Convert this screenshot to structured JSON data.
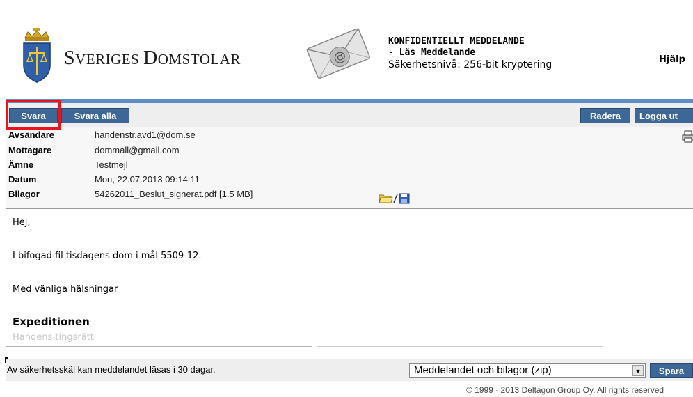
{
  "header": {
    "brand_logo": "SVERIGES DOMSTOLAR",
    "title_line1": "KONFIDENTIELLT MEDDELANDE",
    "title_line2": "- Läs Meddelande",
    "security_level": "Säkerhetsnivå: 256-bit kryptering",
    "help_label": "Hjälp",
    "band_color": "#5b8fc4"
  },
  "toolbar": {
    "reply_label": "Svara",
    "reply_all_label": "Svara alla",
    "delete_label": "Radera",
    "logout_label": "Logga ut",
    "button_color": "#3d6796",
    "highlight_color": "#e8151c"
  },
  "meta": {
    "rows": [
      {
        "label": "Avsändare",
        "value": "handenstr.avd1@dom.se"
      },
      {
        "label": "Mottagare",
        "value": "dommall@gmail.com"
      },
      {
        "label": "Ämne",
        "value": "Testmejl"
      },
      {
        "label": "Datum",
        "value": "Mon, 22.07.2013 09:14:11"
      },
      {
        "label": "Bilagor",
        "value": "54262011_Beslut_signerat.pdf [1.5 MB]"
      }
    ],
    "icons": [
      "printer-icon",
      "open-folder-icon",
      "save-disk-icon"
    ]
  },
  "message": {
    "greeting": "Hej,",
    "line1": "I bifogad fil tisdagens dom i mål 5509-12.",
    "closing": "Med vänliga hälsningar",
    "signature": "Expeditionen",
    "signature_sub": "Handens tingsrätt"
  },
  "footer": {
    "retention_info": "Av säkerhetsskäl kan meddelandet läsas i 30 dagar.",
    "download_option": "Meddelandet och bilagor (zip)",
    "save_label": "Spara",
    "copyright": "© 1999 - 2013 Deltagon Group Oy. All rights reserved"
  }
}
